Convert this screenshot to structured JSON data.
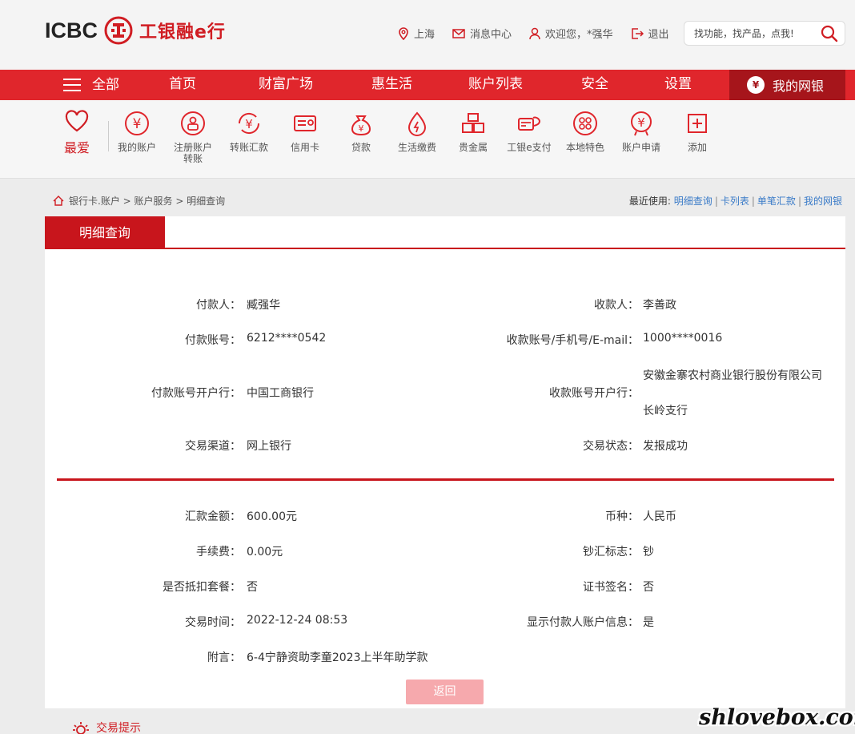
{
  "header": {
    "logo_en": "ICBC",
    "logo_cn": "工银融e行",
    "location": "上海",
    "messages": "消息中心",
    "welcome": "欢迎您，*强华",
    "logout": "退出",
    "search_placeholder": "找功能，找产品，点我!"
  },
  "nav": {
    "all": "全部",
    "items": [
      "首页",
      "财富广场",
      "惠生活",
      "账户列表",
      "安全",
      "设置"
    ],
    "mybank": "我的网银"
  },
  "quick": {
    "fav": "最爱",
    "items": [
      {
        "label": "我的账户",
        "icon": "yen-circle-icon"
      },
      {
        "label": "注册账户转账",
        "icon": "registered-transfer-icon"
      },
      {
        "label": "转账汇款",
        "icon": "transfer-icon"
      },
      {
        "label": "信用卡",
        "icon": "credit-card-icon"
      },
      {
        "label": "贷款",
        "icon": "loan-bag-icon"
      },
      {
        "label": "生活缴费",
        "icon": "utility-drop-icon"
      },
      {
        "label": "贵金属",
        "icon": "gold-bars-icon"
      },
      {
        "label": "工银e支付",
        "icon": "epay-icon"
      },
      {
        "label": "本地特色",
        "icon": "local-icon"
      },
      {
        "label": "账户申请",
        "icon": "account-apply-icon"
      },
      {
        "label": "添加",
        "icon": "add-icon"
      }
    ]
  },
  "breadcrumb": {
    "path": "银行卡.账户 > 账户服务 > 明细查询",
    "recent_label": "最近使用:",
    "recent": [
      "明细查询",
      "卡列表",
      "单笔汇款",
      "我的网银"
    ]
  },
  "panel": {
    "title": "明细查询",
    "payer_label": "付款人：",
    "payer": "臧强华",
    "payee_label": "收款人：",
    "payee": "李善政",
    "payer_acct_label": "付款账号：",
    "payer_acct": "6212****0542",
    "payee_acct_label": "收款账号/手机号/E-mail：",
    "payee_acct": "1000****0016",
    "payer_bank_label": "付款账号开户行：",
    "payer_bank": "中国工商银行",
    "payee_bank_label": "收款账号开户行：",
    "payee_bank_line1": "安徽金寨农村商业银行股份有限公司",
    "payee_bank_line2": "长岭支行",
    "channel_label": "交易渠道：",
    "channel": "网上银行",
    "status_label": "交易状态：",
    "status": "发报成功",
    "amount_label": "汇款金额：",
    "amount": "600.00元",
    "currency_label": "币种：",
    "currency": "人民币",
    "fee_label": "手续费：",
    "fee": "0.00元",
    "cash_flag_label": "钞汇标志：",
    "cash_flag": "钞",
    "package_label": "是否抵扣套餐：",
    "package": "否",
    "cert_label": "证书签名：",
    "cert": "否",
    "time_label": "交易时间：",
    "time": "2022-12-24 08:53",
    "show_payer_label": "显示付款人账户信息：",
    "show_payer": "是",
    "memo_label": "附言：",
    "memo": "6-4宁静资助李童2023上半年助学款",
    "back": "返回"
  },
  "tips": "交易提示",
  "watermark": "shlovebox.com",
  "colors": {
    "brand_red": "#e0262c",
    "dark_red": "#c8151c",
    "link_blue": "#3a7bc8",
    "back_button": "#f6a9ad"
  }
}
